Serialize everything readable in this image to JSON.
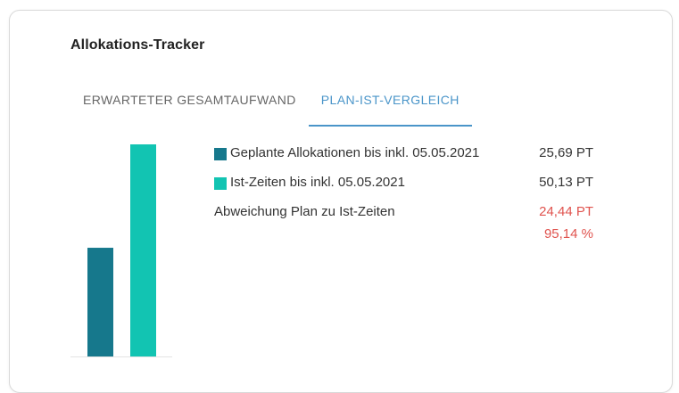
{
  "card": {
    "title": "Allokations-Tracker"
  },
  "tabs": [
    {
      "label": "ERWARTETER GESAMTAUFWAND",
      "active": false
    },
    {
      "label": "PLAN-IST-VERGLEICH",
      "active": true
    }
  ],
  "legend": {
    "planned": {
      "label": "Geplante Allokationen bis inkl. 05.05.2021",
      "value": "25,69 PT",
      "color": "#16788c"
    },
    "actual": {
      "label": "Ist-Zeiten bis inkl. 05.05.2021",
      "value": "50,13 PT",
      "color": "#12c4b2"
    },
    "deviation": {
      "label": "Abweichung Plan zu Ist-Zeiten",
      "value": "24,44 PT",
      "percent": "95,14 %",
      "color": "#e0534e"
    }
  },
  "chart_data": {
    "type": "bar",
    "categories": [
      "Geplante Allokationen bis inkl. 05.05.2021",
      "Ist-Zeiten bis inkl. 05.05.2021"
    ],
    "values": [
      25.69,
      50.13
    ],
    "colors": [
      "#16788c",
      "#12c4b2"
    ],
    "ylim": [
      0,
      50.13
    ],
    "grid": false,
    "legend": "right"
  }
}
